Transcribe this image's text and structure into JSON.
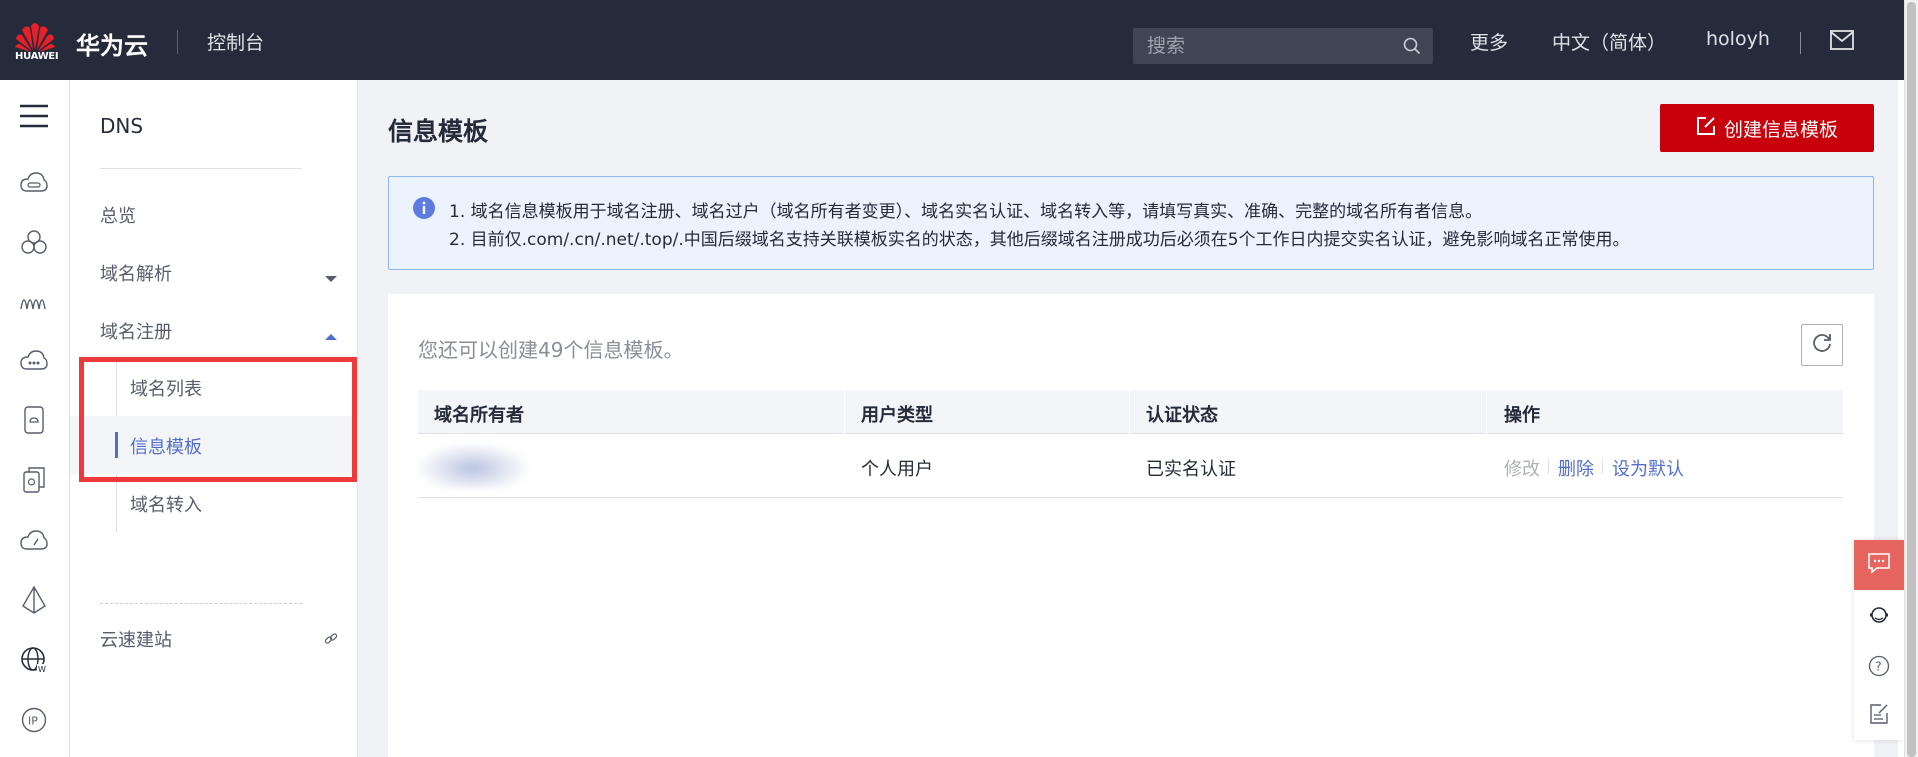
{
  "header": {
    "logo_text": "HUAWEI",
    "brand": "华为云",
    "console": "控制台",
    "search_placeholder": "搜索",
    "more": "更多",
    "language": "中文（简体）",
    "username": "holoyh"
  },
  "rail": {
    "icons": [
      "menu-icon",
      "cloud-dns-icon",
      "cluster-icon",
      "wave-icon",
      "cloud-server-icon",
      "phone-icon",
      "copy-icon",
      "cloud-speed-icon",
      "pyramid-icon",
      "globe-icon",
      "ip-icon"
    ]
  },
  "sidenav": {
    "title": "DNS",
    "overview": "总览",
    "domain_resolution": "域名解析",
    "domain_registration": "域名注册",
    "sub_items": [
      "域名列表",
      "信息模板",
      "域名转入"
    ],
    "active_sub_index": 1,
    "cloud_site": "云速建站"
  },
  "main": {
    "title": "信息模板",
    "create_button": "创建信息模板",
    "info_lines": [
      "1. 域名信息模板用于域名注册、域名过户（域名所有者变更）、域名实名认证、域名转入等，请填写真实、准确、完整的域名所有者信息。",
      "2. 目前仅.com/.cn/.net/.top/.中国后缀域名支持关联模板实名的状态，其他后缀域名注册成功后必须在5个工作日内提交实名认证，避免影响域名正常使用。"
    ],
    "remaining": "您还可以创建49个信息模板。",
    "table": {
      "headers": [
        "域名所有者",
        "用户类型",
        "认证状态",
        "操作"
      ],
      "rows": [
        {
          "owner": "",
          "user_type": "个人用户",
          "status": "已实名认证",
          "actions": [
            "修改",
            "删除",
            "设为默认"
          ]
        }
      ]
    }
  },
  "colors": {
    "topbar": "#252b3a",
    "accent": "#c7000b",
    "link": "#526ecc",
    "highlight_box": "#ee3a3a"
  }
}
